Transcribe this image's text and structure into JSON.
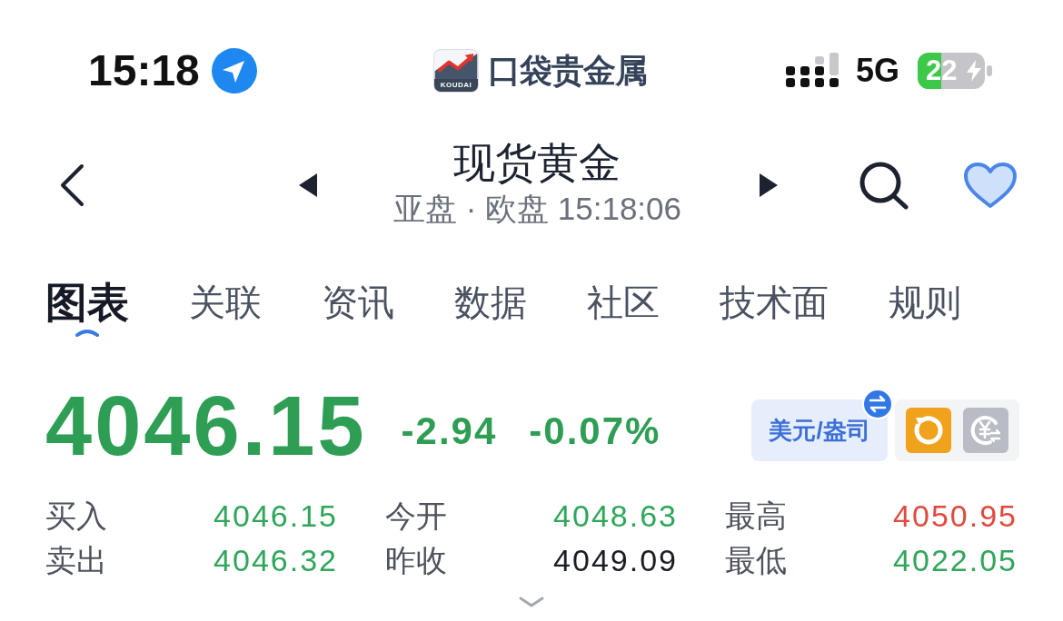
{
  "status_bar": {
    "time": "15:18",
    "network": "5G",
    "battery": "22"
  },
  "app_logo": {
    "caption": "KOUDAI",
    "name": "口袋贵金属"
  },
  "header": {
    "title": "现货黄金",
    "subtitle": "亚盘 · 欧盘 15:18:06"
  },
  "tabs": [
    {
      "label": "图表",
      "selected": true
    },
    {
      "label": "关联",
      "selected": false
    },
    {
      "label": "资讯",
      "selected": false
    },
    {
      "label": "数据",
      "selected": false
    },
    {
      "label": "社区",
      "selected": false
    },
    {
      "label": "技术面",
      "selected": false
    },
    {
      "label": "规则",
      "selected": false
    }
  ],
  "quote": {
    "price": "4046.15",
    "change": "-2.94",
    "change_percent": "-0.07%",
    "unit_button": "美元/盎司"
  },
  "stats": [
    {
      "label": "买入",
      "value": "4046.15",
      "color": "#2fa65a"
    },
    {
      "label": "今开",
      "value": "4048.63",
      "color": "#2fa65a"
    },
    {
      "label": "最高",
      "value": "4050.95",
      "color": "#e04a3f"
    },
    {
      "label": "卖出",
      "value": "4046.32",
      "color": "#2fa65a"
    },
    {
      "label": "昨收",
      "value": "4049.09",
      "color": "#1a1d24"
    },
    {
      "label": "最低",
      "value": "4022.05",
      "color": "#2fa65a"
    }
  ]
}
